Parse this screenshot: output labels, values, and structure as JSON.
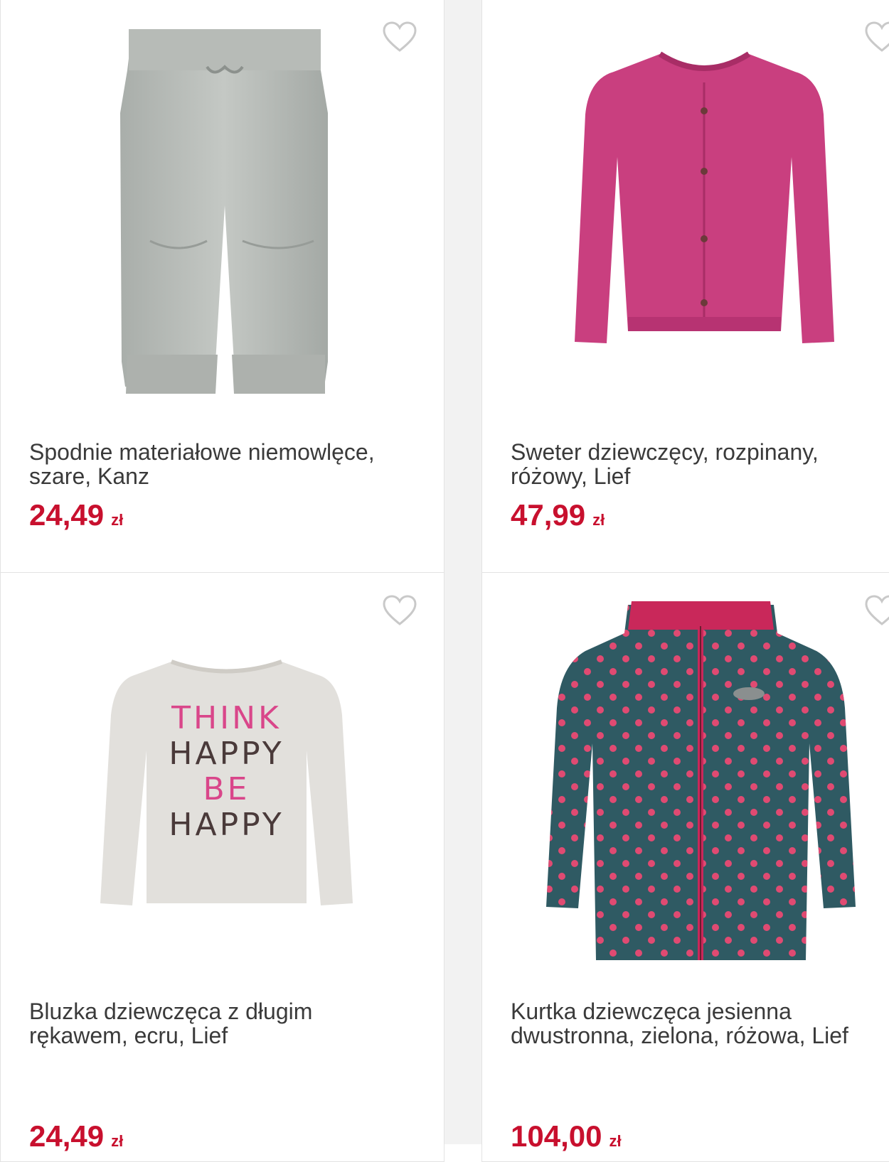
{
  "accent_color": "#c8102e",
  "products": [
    {
      "name": "Spodnie materiałowe niemowlęce, szare, Kanz",
      "price": "24,49",
      "currency": "zł",
      "favorite_icon": "heart-outline-icon",
      "image": "grey-baby-trousers"
    },
    {
      "name": "Sweter dziewczęcy, rozpinany, różowy, Lief",
      "price": "47,99",
      "currency": "zł",
      "favorite_icon": "heart-outline-icon",
      "image": "pink-cardigan"
    },
    {
      "name": "Bluzka dziewczęca z długim rękawem, ecru, Lief",
      "price": "24,49",
      "currency": "zł",
      "favorite_icon": "heart-outline-icon",
      "image": "ecru-long-sleeve-top",
      "print_text": [
        "THINK",
        "HAPPY",
        "BE",
        "HAPPY"
      ]
    },
    {
      "name": "Kurtka dziewczęca jesienna dwustronna, zielona, różowa, Lief",
      "price": "104,00",
      "currency": "zł",
      "favorite_icon": "heart-outline-icon",
      "image": "teal-polka-dot-jacket"
    }
  ]
}
